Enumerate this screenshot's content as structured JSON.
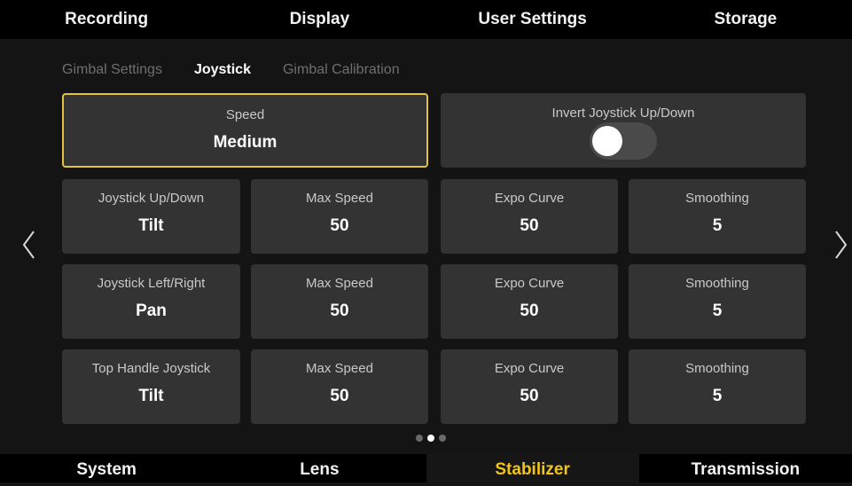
{
  "top_tabs": [
    "Recording",
    "Display",
    "User Settings",
    "Storage"
  ],
  "sub_tabs": [
    "Gimbal Settings",
    "Joystick",
    "Gimbal Calibration"
  ],
  "sub_tab_active": "Joystick",
  "speed": {
    "label": "Speed",
    "value": "Medium"
  },
  "invert": {
    "label": "Invert Joystick Up/Down",
    "state": "off"
  },
  "rows": [
    {
      "name": {
        "label": "Joystick Up/Down",
        "value": "Tilt"
      },
      "max_speed": {
        "label": "Max Speed",
        "value": "50"
      },
      "expo": {
        "label": "Expo Curve",
        "value": "50"
      },
      "smoothing": {
        "label": "Smoothing",
        "value": "5"
      }
    },
    {
      "name": {
        "label": "Joystick Left/Right",
        "value": "Pan"
      },
      "max_speed": {
        "label": "Max Speed",
        "value": "50"
      },
      "expo": {
        "label": "Expo Curve",
        "value": "50"
      },
      "smoothing": {
        "label": "Smoothing",
        "value": "5"
      }
    },
    {
      "name": {
        "label": "Top Handle Joystick",
        "value": "Tilt"
      },
      "max_speed": {
        "label": "Max Speed",
        "value": "50"
      },
      "expo": {
        "label": "Expo Curve",
        "value": "50"
      },
      "smoothing": {
        "label": "Smoothing",
        "value": "5"
      }
    }
  ],
  "pagination": {
    "pages": 3,
    "current": 2
  },
  "icons": {
    "prev": "chevron-left-icon",
    "next": "chevron-right-icon"
  },
  "bottom_tabs": [
    "System",
    "Lens",
    "Stabilizer",
    "Transmission"
  ],
  "bottom_tab_active": "Stabilizer",
  "colors": {
    "accent": "#f0c419",
    "selected_border": "#e2c23a",
    "card": "#333333",
    "background": "#141414"
  }
}
